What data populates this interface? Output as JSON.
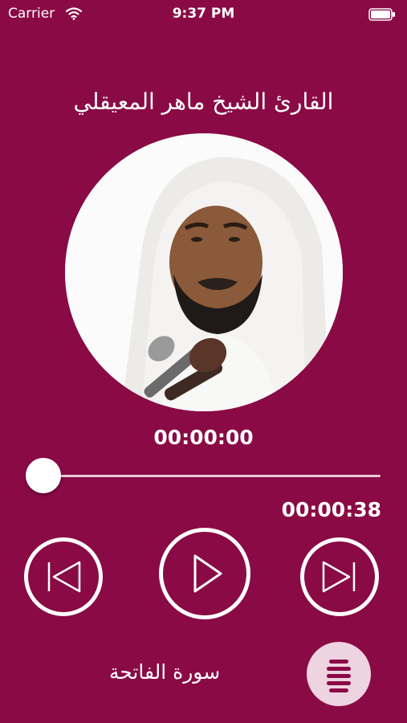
{
  "status_bar": {
    "carrier": "Carrier",
    "time": "9:37 PM"
  },
  "header": {
    "reciter": "القارئ الشيخ ماهر المعيقلي"
  },
  "player": {
    "elapsed": "00:00:00",
    "duration": "00:00:38",
    "progress": 0
  },
  "footer": {
    "surah_name": "سورة الفاتحة"
  },
  "colors": {
    "background": "#8a0a45",
    "foreground": "#ffffff",
    "menu_button": "#eed3e0"
  },
  "icons": {
    "previous": "skip-previous-icon",
    "play": "play-icon",
    "next": "skip-next-icon",
    "menu": "list-menu-icon"
  }
}
